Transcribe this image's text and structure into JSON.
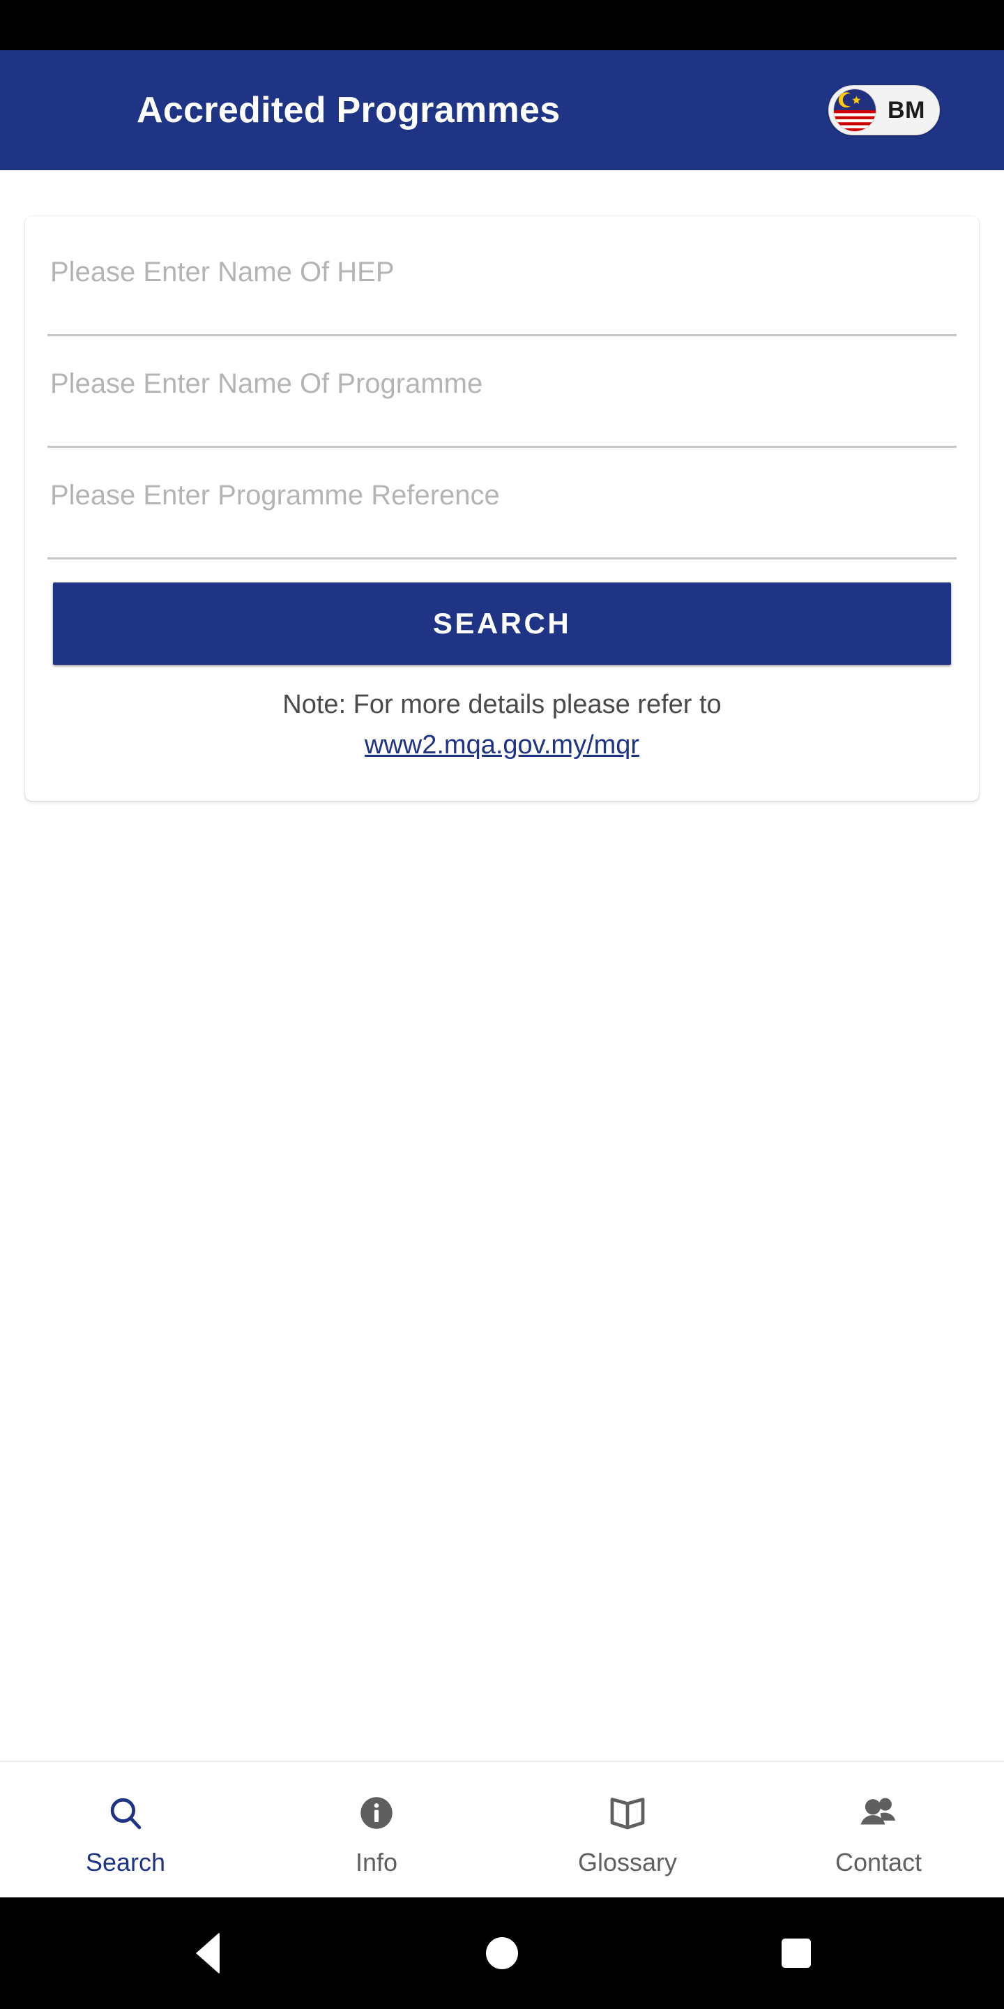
{
  "app_bar": {
    "title": "Accredited Programmes",
    "language_toggle": {
      "label": "BM",
      "icon": "malaysia-flag-icon"
    },
    "background_color": "#1f3485"
  },
  "search_form": {
    "fields": [
      {
        "name": "hep",
        "placeholder": "Please Enter Name Of HEP",
        "value": ""
      },
      {
        "name": "programme",
        "placeholder": "Please Enter Name Of Programme",
        "value": ""
      },
      {
        "name": "programme_reference",
        "placeholder": "Please Enter Programme Reference",
        "value": ""
      }
    ],
    "search_button_label": "SEARCH",
    "note_text": "Note: For more details please refer to",
    "note_link_text": "www2.mqa.gov.my/mqr"
  },
  "bottom_nav": {
    "items": [
      {
        "label": "Search",
        "icon": "search-icon",
        "active": true
      },
      {
        "label": "Info",
        "icon": "info-icon",
        "active": false
      },
      {
        "label": "Glossary",
        "icon": "book-icon",
        "active": false
      },
      {
        "label": "Contact",
        "icon": "people-icon",
        "active": false
      }
    ],
    "active_color": "#1f3485",
    "inactive_color": "#5f5f5f"
  },
  "system_nav": {
    "back_label": "Back",
    "home_label": "Home",
    "recents_label": "Recents"
  }
}
